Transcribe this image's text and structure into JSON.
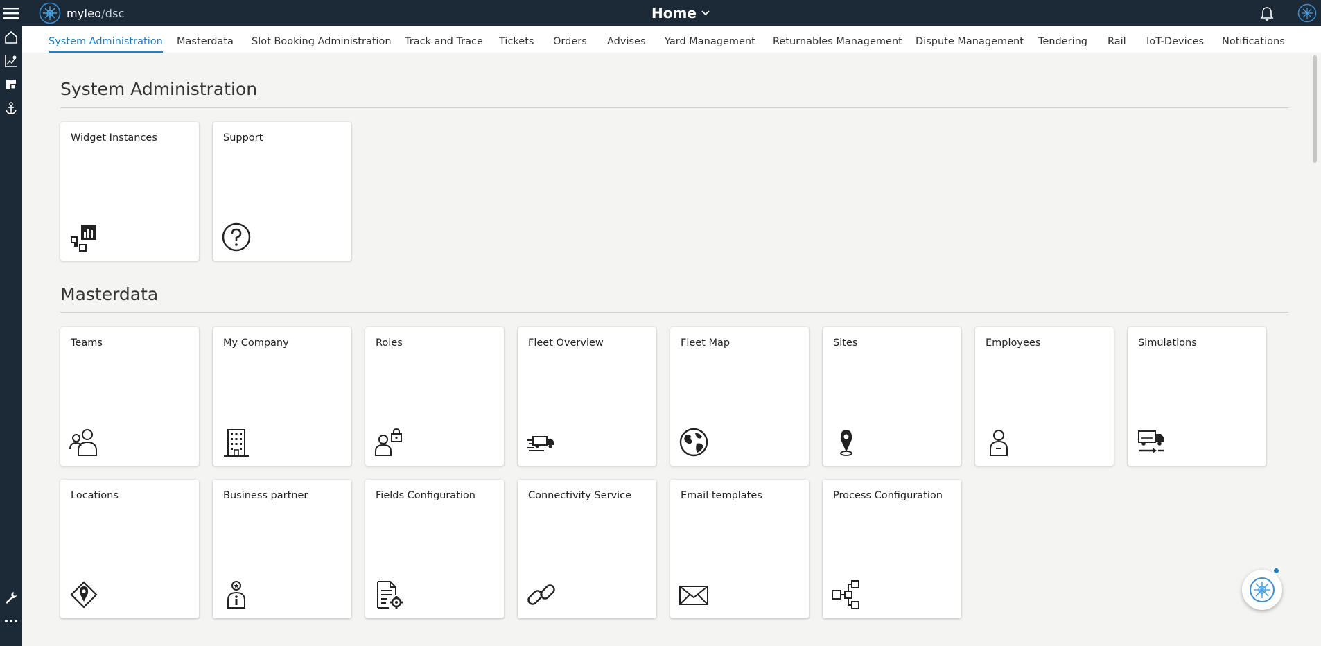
{
  "brand": {
    "name": "myleo",
    "separator": "/",
    "sub": "dsc"
  },
  "header": {
    "page_title": "Home"
  },
  "tabs": [
    "System Administration",
    "Masterdata",
    "Slot Booking Administration",
    "Track and Trace",
    "Tickets",
    "Orders",
    "Advises",
    "Yard Management",
    "Returnables Management",
    "Dispute Management",
    "Tendering",
    "Rail",
    "IoT-Devices",
    "Notifications"
  ],
  "sections": {
    "system_admin": {
      "title": "System Administration",
      "tiles": [
        {
          "label": "Widget Instances",
          "icon": "widget-instances-icon"
        },
        {
          "label": "Support",
          "icon": "question-circle-icon"
        }
      ]
    },
    "masterdata": {
      "title": "Masterdata",
      "tiles": [
        {
          "label": "Teams",
          "icon": "people-icon"
        },
        {
          "label": "My Company",
          "icon": "building-icon"
        },
        {
          "label": "Roles",
          "icon": "user-lock-icon"
        },
        {
          "label": "Fleet Overview",
          "icon": "fleet-truck-icon"
        },
        {
          "label": "Fleet Map",
          "icon": "globe-icon"
        },
        {
          "label": "Sites",
          "icon": "map-pin-icon"
        },
        {
          "label": "Employees",
          "icon": "person-icon"
        },
        {
          "label": "Simulations",
          "icon": "truck-simulation-icon"
        },
        {
          "label": "Locations",
          "icon": "location-diamond-icon"
        },
        {
          "label": "Business partner",
          "icon": "business-partner-icon"
        },
        {
          "label": "Fields Configuration",
          "icon": "document-gear-icon"
        },
        {
          "label": "Connectivity Service",
          "icon": "link-icon"
        },
        {
          "label": "Email templates",
          "icon": "envelope-icon"
        },
        {
          "label": "Process Configuration",
          "icon": "process-flow-icon"
        }
      ]
    }
  },
  "colors": {
    "topbar": "#1c2a38",
    "accent": "#1f7fc1",
    "background": "#f4f4f2"
  }
}
